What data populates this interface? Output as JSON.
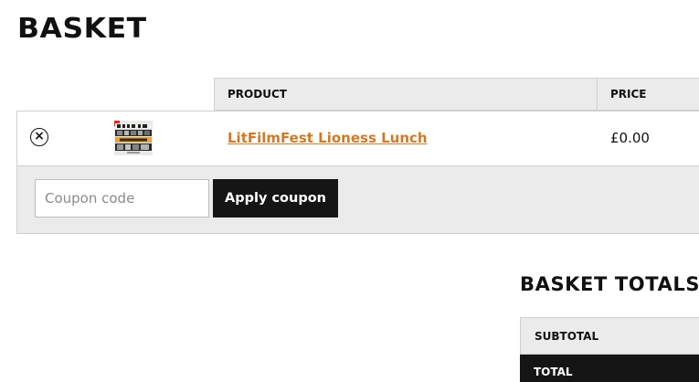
{
  "page": {
    "title": "BASKET"
  },
  "cart": {
    "headers": {
      "product": "PRODUCT",
      "price": "PRICE"
    },
    "items": [
      {
        "remove_icon": "close-circle-icon",
        "remove_glyph": "×",
        "product_name": "LitFilmFest Lioness Lunch",
        "price": "£0.00"
      }
    ],
    "coupon": {
      "placeholder": "Coupon code",
      "value": "",
      "button_label": "Apply coupon"
    }
  },
  "totals": {
    "title": "BASKET TOTALS",
    "subtotal_label": "SUBTOTAL",
    "total_label": "TOTAL"
  },
  "colors": {
    "accent_link": "#cc7a2a",
    "button_dark": "#151515",
    "table_header_bg": "#ebebeb",
    "border": "#cfcfcf"
  }
}
